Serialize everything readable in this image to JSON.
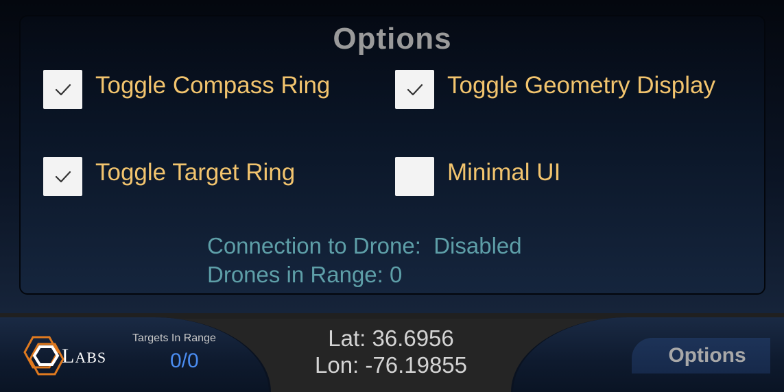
{
  "options_panel": {
    "title": "Options",
    "toggles": [
      {
        "label": "Toggle Compass Ring",
        "checked": true
      },
      {
        "label": "Toggle Geometry Display",
        "checked": true
      },
      {
        "label": "Toggle Target Ring",
        "checked": true
      },
      {
        "label": "Minimal UI",
        "checked": false
      }
    ],
    "connection_status": "Connection to Drone:  Disabled",
    "drones_in_range": "Drones in Range: 0"
  },
  "bottom_bar": {
    "logo_text_first": "L",
    "logo_text_rest": "ABS",
    "targets_label": "Targets In Range",
    "targets_value": "0/0",
    "lat": "Lat: 36.6956",
    "lon": "Lon: -76.19855",
    "options_button_label": "Options"
  },
  "colors": {
    "label_accent": "#f2c46e",
    "status_teal": "#5e9fa8",
    "targets_blue": "#4a8cf0",
    "logo_orange": "#e07a1f"
  },
  "icons": {
    "check": "check-icon",
    "logo": "hexagon-logo-icon"
  }
}
